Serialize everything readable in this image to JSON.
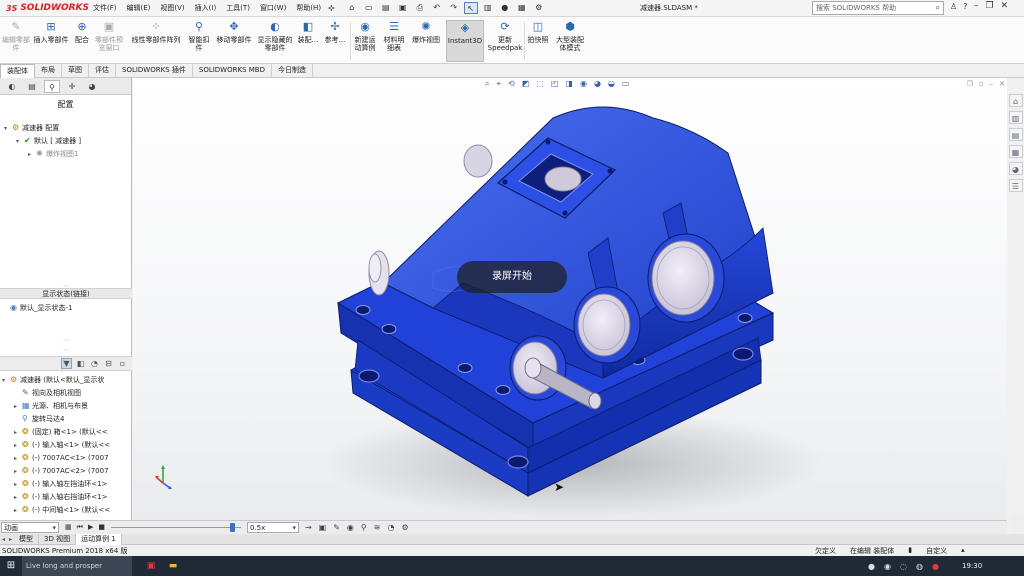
{
  "app": {
    "logo": "SOLIDWORKS",
    "document_title": "减速器.SLDASM *"
  },
  "menu": [
    "文件(F)",
    "编辑(E)",
    "视图(V)",
    "插入(I)",
    "工具(T)",
    "窗口(W)",
    "帮助(H)"
  ],
  "search": {
    "placeholder": "搜索 SOLIDWORKS 帮助"
  },
  "ribbon": {
    "buttons": [
      {
        "label": "编辑零部件",
        "icon": "edit-component-icon",
        "enabled": false
      },
      {
        "label": "插入零部件",
        "icon": "insert-component-icon",
        "enabled": true
      },
      {
        "label": "配合",
        "icon": "mate-icon",
        "enabled": true
      },
      {
        "label": "零部件预览窗口",
        "icon": "component-preview-icon",
        "enabled": false
      },
      {
        "label": "线性零部件阵列",
        "icon": "linear-pattern-icon",
        "enabled": true
      },
      {
        "label": "智能扣件",
        "icon": "smart-fastener-icon",
        "enabled": true
      },
      {
        "label": "移动零部件",
        "icon": "move-component-icon",
        "enabled": true
      },
      {
        "label": "显示隐藏的零部件",
        "icon": "show-hidden-icon",
        "enabled": true
      },
      {
        "label": "装配...",
        "icon": "assembly-features-icon",
        "enabled": true
      },
      {
        "label": "参考...",
        "icon": "reference-geometry-icon",
        "enabled": true
      },
      {
        "label": "新建运动算例",
        "icon": "new-motion-study-icon",
        "enabled": true
      },
      {
        "label": "材料明细表",
        "icon": "bom-icon",
        "enabled": true
      },
      {
        "label": "爆炸视图",
        "icon": "exploded-view-icon",
        "enabled": true
      },
      {
        "label": "Instant3D",
        "icon": "instant3d-icon",
        "enabled": true,
        "active": true
      },
      {
        "label": "更新Speedpak",
        "icon": "speedpak-icon",
        "enabled": true
      },
      {
        "label": "拍快照",
        "icon": "snapshot-icon",
        "enabled": true
      },
      {
        "label": "大型装配体模式",
        "icon": "large-assembly-icon",
        "enabled": true
      }
    ]
  },
  "command_tabs": [
    {
      "label": "装配体",
      "active": true
    },
    {
      "label": "布局"
    },
    {
      "label": "草图"
    },
    {
      "label": "评估"
    },
    {
      "label": "SOLIDWORKS 插件"
    },
    {
      "label": "SOLIDWORKS MBD"
    },
    {
      "label": "今日制造"
    }
  ],
  "config_panel": {
    "heading": "配置",
    "tree": [
      {
        "label": "减速器 配置"
      },
      {
        "label": "默认 [ 减速器 ]"
      },
      {
        "label": "爆炸视图1"
      }
    ],
    "display_state_heading": "显示状态(链接)",
    "display_state": "默认_显示状态-1"
  },
  "feature_tree": [
    {
      "label": "减速器 (默认<默认_显示状"
    },
    {
      "label": "视向及相机视图"
    },
    {
      "label": "光源、相机与布景"
    },
    {
      "label": "旋转马达4"
    },
    {
      "label": "(固定) 箱<1> (默认<<"
    },
    {
      "label": "(-) 输入轴<1> (默认<<"
    },
    {
      "label": "(-) 7007AC<1> (7007"
    },
    {
      "label": "(-) 7007AC<2> (7007"
    },
    {
      "label": "(-) 输入轴左挡油环<1>"
    },
    {
      "label": "(-) 输入轴右挡油环<1>"
    },
    {
      "label": "(-) 中间轴<1> (默认<<"
    }
  ],
  "viewport": {
    "overlay_text": "录屏开始"
  },
  "motion_manager": {
    "study_type": "动画",
    "speed": "0.5x",
    "time_fraction": 0.95
  },
  "model_tabs": [
    {
      "label": "模型"
    },
    {
      "label": "3D 视图"
    },
    {
      "label": "运动算例 1",
      "active": true
    }
  ],
  "status": {
    "product": "SOLIDWORKS Premium 2018 x64 版",
    "state": "欠定义",
    "editing": "在编辑 装配体",
    "units": "自定义"
  },
  "taskbar": {
    "search_text": "Live long and prosper",
    "time": "19:30"
  },
  "colors": {
    "part_blue": "#1f47d6",
    "solidworks_red": "#d71f26"
  }
}
